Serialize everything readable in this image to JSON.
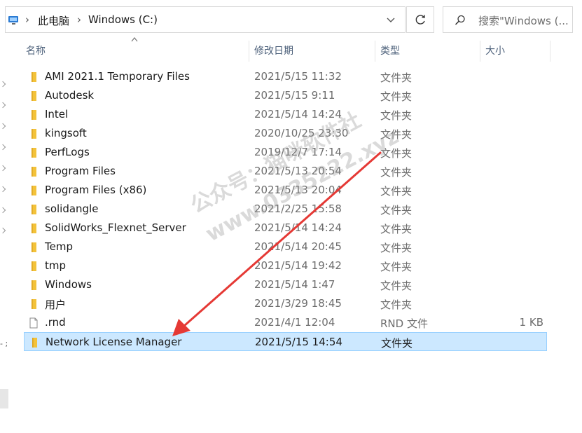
{
  "address_bar": {
    "crumbs": [
      "此电脑",
      "Windows (C:)"
    ],
    "icon": "computer-icon"
  },
  "search": {
    "placeholder": "搜索\"Windows (..."
  },
  "columns": {
    "name": "名称",
    "date": "修改日期",
    "type": "类型",
    "size": "大小"
  },
  "files": [
    {
      "name": "AMI 2021.1 Temporary Files",
      "date": "2021/5/15 11:32",
      "type": "文件夹",
      "size": "",
      "icon": "folder-icon"
    },
    {
      "name": "Autodesk",
      "date": "2021/5/15 9:11",
      "type": "文件夹",
      "size": "",
      "icon": "folder-icon"
    },
    {
      "name": "Intel",
      "date": "2021/5/14 14:24",
      "type": "文件夹",
      "size": "",
      "icon": "folder-icon"
    },
    {
      "name": "kingsoft",
      "date": "2020/10/25 23:30",
      "type": "文件夹",
      "size": "",
      "icon": "folder-icon"
    },
    {
      "name": "PerfLogs",
      "date": "2019/12/7 17:14",
      "type": "文件夹",
      "size": "",
      "icon": "folder-icon"
    },
    {
      "name": "Program Files",
      "date": "2021/5/13 20:54",
      "type": "文件夹",
      "size": "",
      "icon": "folder-icon"
    },
    {
      "name": "Program Files (x86)",
      "date": "2021/5/13 20:04",
      "type": "文件夹",
      "size": "",
      "icon": "folder-icon"
    },
    {
      "name": "solidangle",
      "date": "2021/2/25 15:58",
      "type": "文件夹",
      "size": "",
      "icon": "folder-icon"
    },
    {
      "name": "SolidWorks_Flexnet_Server",
      "date": "2021/5/14 14:24",
      "type": "文件夹",
      "size": "",
      "icon": "folder-icon"
    },
    {
      "name": "Temp",
      "date": "2021/5/14 20:45",
      "type": "文件夹",
      "size": "",
      "icon": "folder-icon"
    },
    {
      "name": "tmp",
      "date": "2021/5/14 19:42",
      "type": "文件夹",
      "size": "",
      "icon": "folder-icon"
    },
    {
      "name": "Windows",
      "date": "2021/5/14 1:47",
      "type": "文件夹",
      "size": "",
      "icon": "folder-icon"
    },
    {
      "name": "用户",
      "date": "2021/3/29 18:45",
      "type": "文件夹",
      "size": "",
      "icon": "folder-icon"
    },
    {
      "name": ".rnd",
      "date": "2021/4/1 12:04",
      "type": "RND 文件",
      "size": "1 KB",
      "icon": "file-icon"
    },
    {
      "name": "Network License Manager",
      "date": "2021/5/15 14:54",
      "type": "文件夹",
      "size": "",
      "icon": "folder-icon",
      "selected": true
    }
  ],
  "watermark": {
    "line1": "公众号：猫咪软件社",
    "line2": "www.0335222.xyz"
  },
  "annotation": {
    "color": "#e53935"
  }
}
